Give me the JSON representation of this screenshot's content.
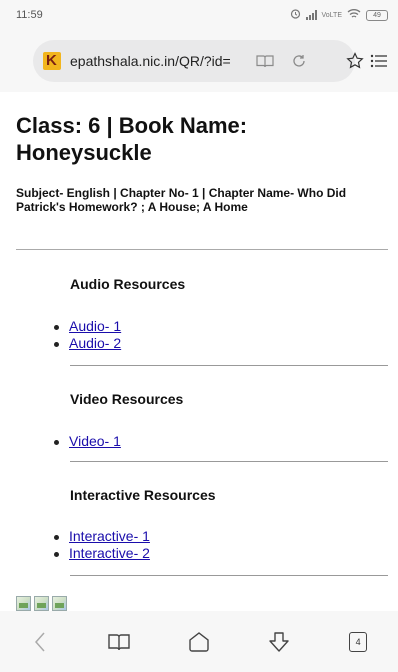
{
  "status_bar": {
    "time": "11:59",
    "battery": "49"
  },
  "browser": {
    "url": "epathshala.nic.in/QR/?id=",
    "tab_count": "4"
  },
  "page": {
    "title": "Class: 6 | Book Name: Honeysuckle",
    "subtitle": "Subject- English | Chapter No- 1 | Chapter Name- Who Did Patrick's Homework? ; A House; A Home"
  },
  "sections": {
    "audio": {
      "heading": "Audio Resources",
      "links": [
        "Audio- 1",
        "Audio- 2"
      ]
    },
    "video": {
      "heading": "Video Resources",
      "links": [
        "Video- 1"
      ]
    },
    "interactive": {
      "heading": "Interactive Resources",
      "links": [
        "Interactive- 1",
        "Interactive- 2"
      ]
    }
  },
  "icons": {
    "url_bar": [
      "reader-mode-icon",
      "reload-icon"
    ],
    "toolbar": [
      "star-icon",
      "menu-icon"
    ],
    "bottom_nav": [
      "back-icon",
      "bookmarks-icon",
      "home-icon",
      "download-icon",
      "tabs-icon"
    ]
  },
  "colors": {
    "link": "#1a0dab",
    "favicon": "#f2b51d",
    "chrome": "#f7f7f7"
  }
}
